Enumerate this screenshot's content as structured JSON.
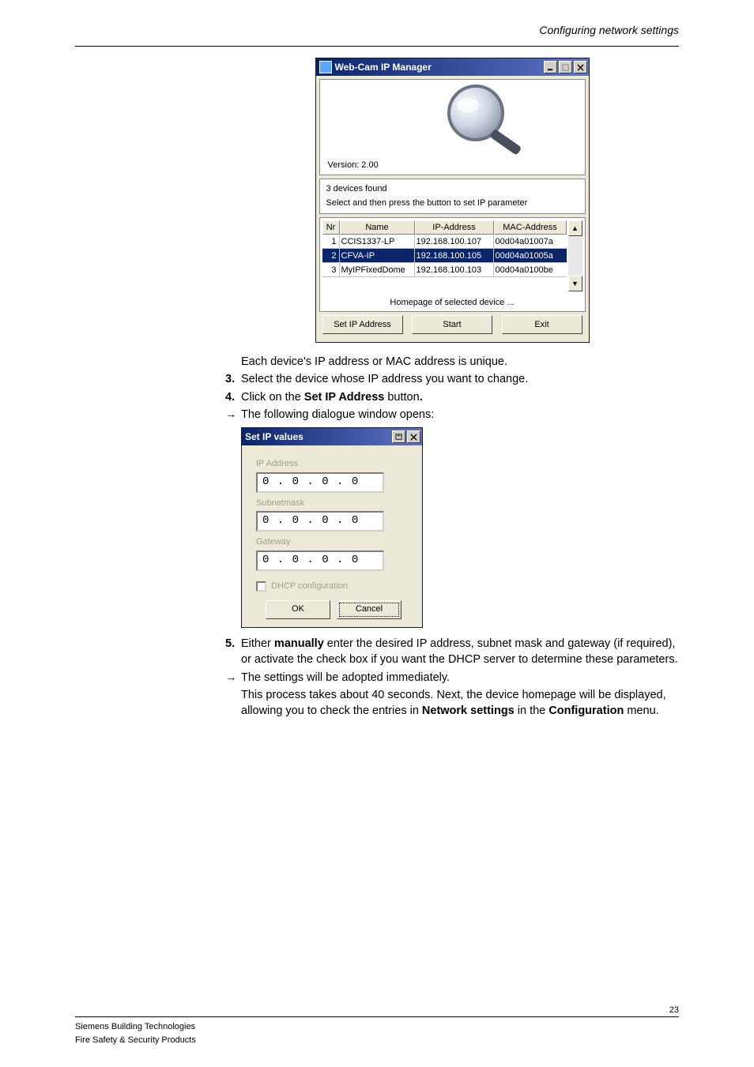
{
  "header_right": "Configuring network settings",
  "ipmanager": {
    "title": "Web-Cam IP Manager",
    "version": "Version: 2.00",
    "status_line1": "3 devices found",
    "status_line2": "Select and then press the button to set IP parameter",
    "cols": {
      "nr": "Nr",
      "name": "Name",
      "ip": "IP-Address",
      "mac": "MAC-Address"
    },
    "rows": [
      {
        "nr": "1",
        "name": "CCIS1337-LP",
        "ip": "192.168.100.107",
        "mac": "00d04a01007a"
      },
      {
        "nr": "2",
        "name": "CFVA-IP",
        "ip": "192.168.100.105",
        "mac": "00d04a01005a"
      },
      {
        "nr": "3",
        "name": "MyIPFixedDome",
        "ip": "192.168.100.103",
        "mac": "00d04a0100be"
      }
    ],
    "selected_index": 1,
    "homepage_label": "Homepage of selected device ...",
    "btn_set": "Set IP Address",
    "btn_start": "Start",
    "btn_exit": "Exit"
  },
  "body": {
    "unique": "Each device's IP address or MAC address is unique.",
    "step3": "Select the device whose IP address you want to change.",
    "step4_pre": "Click on the ",
    "step4_bold": "Set IP Address",
    "step4_post": " button",
    "dot": ".",
    "dialog_opens": "The following dialogue window opens:",
    "step5_pre": "Either ",
    "step5_bold": "manually",
    "step5_post": " enter the desired IP address, subnet mask and gateway (if required), or activate the check box if you want the DHCP server to determine these parameters.",
    "post_1": "The settings will be adopted immediately.",
    "post_2_pre": "This process takes about 40 seconds. Next, the device homepage will be displayed, allowing you to check the entries in ",
    "post_2_b1": "Network settings",
    "post_2_mid": " in the ",
    "post_2_b2": "Configuration",
    "post_2_post": " menu."
  },
  "setip": {
    "title": "Set IP values",
    "ip_label": "IP Address",
    "subnet_label": "Subnetmask",
    "gw_label": "Gateway",
    "ipval": "0 . 0 . 0 . 0",
    "dhcp_label": "DHCP configuration",
    "ok": "OK",
    "cancel": "Cancel"
  },
  "footer": {
    "left1": "Siemens Building Technologies",
    "left2": "Fire Safety & Security Products",
    "page": "23"
  },
  "nums": {
    "three": "3.",
    "four": "4.",
    "five": "5."
  },
  "glyph": {
    "arrow": "→"
  }
}
